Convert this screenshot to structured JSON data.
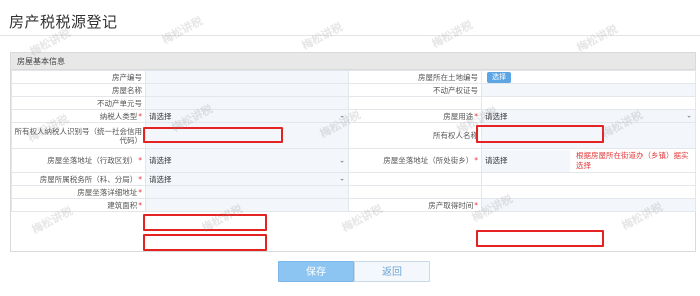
{
  "page": {
    "title": "房产税税源登记"
  },
  "panel": {
    "title": "房屋基本信息"
  },
  "form": {
    "row1": {
      "label_left": "房产编号",
      "value_left": "",
      "label_right": "房屋所在土地编号",
      "button": "选择"
    },
    "row2": {
      "label_left": "房屋名称",
      "value_left": "",
      "label_right": "不动产权证号",
      "value_right": ""
    },
    "row3": {
      "label_left": "不动产单元号",
      "value_left": ""
    },
    "row4": {
      "label_left": "纳税人类型",
      "req_left": "*",
      "select_left": "请选择",
      "label_right": "房屋用途",
      "req_right": "*",
      "select_right": "请选择"
    },
    "row5": {
      "label_left": "所有权人纳税人识别号（统一社会信用代码）",
      "value_left": "",
      "label_right": "所有权人名称",
      "value_right": ""
    },
    "row6": {
      "label_left": "房屋坐落地址（行政区划）",
      "req_left": "*",
      "select_left": "请选择",
      "label_right": "房屋坐落地址（所处街乡）",
      "req_right": "*",
      "select_right": "请选择",
      "hint": "根据房屋所在街道办（乡镇）据实选择"
    },
    "row7": {
      "label_left": "房屋所属税务所（科、分局）",
      "req_left": "*",
      "select_left": "请选择"
    },
    "row8": {
      "label_left": "房屋坐落详细地址",
      "req_left": "*",
      "value_left": ""
    },
    "row9": {
      "label_left": "建筑面积",
      "req_left": "*",
      "value_left": "",
      "label_right": "房产取得时间",
      "req_right": "*",
      "value_right": ""
    }
  },
  "actions": {
    "save": "保存",
    "back": "返回"
  },
  "watermark": {
    "text": "梅松讲税"
  },
  "colors": {
    "highlight": "#e52323",
    "required": "#e03b3b",
    "save_bg": "#8dc5f2"
  }
}
